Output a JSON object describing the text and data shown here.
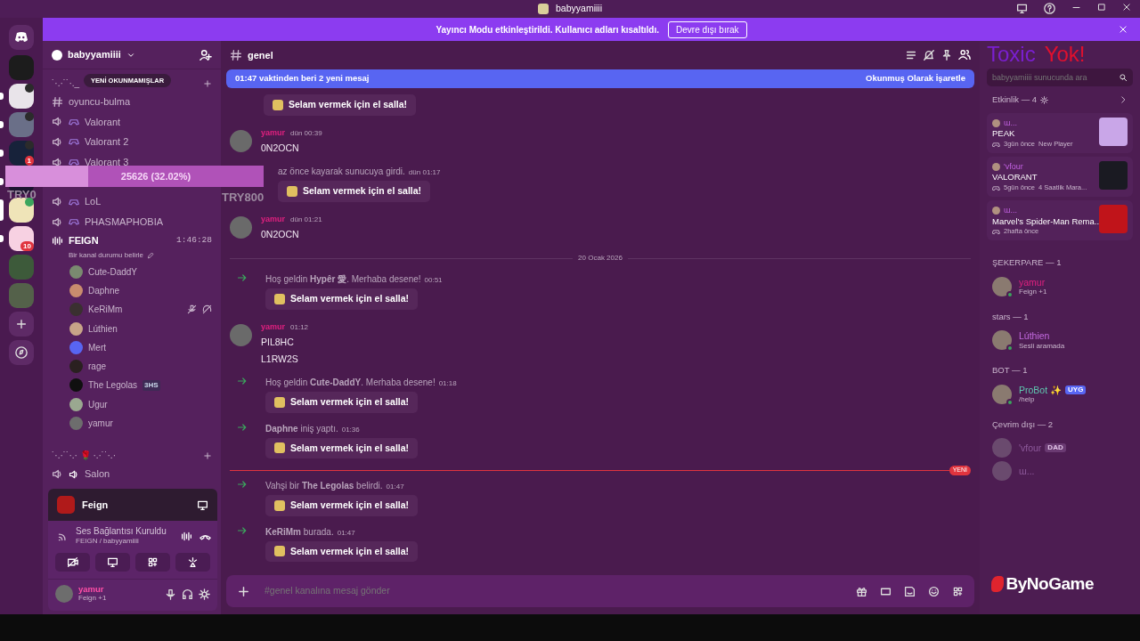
{
  "title_bar": {
    "title": "babyyamiiii"
  },
  "streamer_banner": {
    "text": "Yayıncı Modu etkinleştirildi. Kullanıcı adları kısaltıldı.",
    "button": "Devre dışı bırak"
  },
  "servers": [
    {
      "selected": false,
      "unread": false,
      "voice": false
    },
    {
      "selected": false,
      "unread": true,
      "voice": true
    },
    {
      "selected": false,
      "unread": true,
      "voice": true
    },
    {
      "selected": false,
      "unread": true,
      "voice": true,
      "mentions": "1"
    },
    {
      "selected": false,
      "unread": true,
      "voice": false
    },
    {
      "selected": true,
      "unread": false,
      "voice": true
    },
    {
      "selected": false,
      "unread": true,
      "voice": false,
      "mentions": "10"
    },
    {
      "selected": false,
      "unread": false,
      "voice": false
    },
    {
      "selected": false,
      "unread": false,
      "voice": false
    }
  ],
  "sidebar": {
    "server_name": "babyyamiiii",
    "unread_pill": "YENİ OKUNMAMIŞLAR",
    "categories": [
      {
        "name": "˙·.·˙˙·._",
        "channels": [
          {
            "kind": "text",
            "name": "oyuncu-bulma"
          },
          {
            "kind": "voice",
            "name": "Valorant",
            "activity": true
          },
          {
            "kind": "voice",
            "name": "Valorant 2",
            "activity": true
          },
          {
            "kind": "voice",
            "name": "Valorant 3",
            "activity": true
          },
          {
            "kind": "voice",
            "name": "LoL",
            "activity": true
          },
          {
            "kind": "voice",
            "name": "PHASMAPHOBIA",
            "activity": true
          },
          {
            "kind": "live",
            "name": "FEIGN",
            "timer": "1:46:28",
            "status": "Bir kanal durumu belirle",
            "members": [
              {
                "name": "Cute-DaddY",
                "muted": false
              },
              {
                "name": "Daphne",
                "muted": false
              },
              {
                "name": "KeRiMm",
                "muted": true
              },
              {
                "name": "Lúthien",
                "muted": false
              },
              {
                "name": "Mert",
                "muted": false
              },
              {
                "name": "rage",
                "muted": false
              },
              {
                "name": "The Legolas",
                "muted": false,
                "tag": "3HS"
              },
              {
                "name": "Ugur",
                "muted": false
              },
              {
                "name": "yamur",
                "muted": false
              }
            ]
          }
        ]
      },
      {
        "name": "˙·.·˙˙·.· 🌹 ·.·˙˙·.·",
        "channels": [
          {
            "kind": "voice",
            "name": "Salon",
            "activity": false
          }
        ]
      }
    ]
  },
  "voice_panel": {
    "stream": "Feign",
    "status": "Ses Bağlantısı Kuruldu",
    "location": "FEIGN / babyyamiiii"
  },
  "user_panel": {
    "name": "yamur",
    "activity": "Feign +1"
  },
  "chat": {
    "channel": "genel",
    "search": {
      "placeholder": "babyyamiiii sunucunda ara"
    },
    "new_bar": {
      "text": "01:47 vaktinden beri 2 yeni mesaj",
      "action": "Okunmuş Olarak İşaretle"
    },
    "items": [
      {
        "kind": "wave",
        "wave": "Selam vermek için el salla!"
      },
      {
        "kind": "message",
        "author": "yamur",
        "time": "dün 00:39",
        "lines": [
          "0N2OCN"
        ]
      },
      {
        "kind": "join",
        "text": "az önce kayarak sunucuya girdi.",
        "time": "dün 01:17",
        "wave": "Selam vermek için el salla!"
      },
      {
        "kind": "message",
        "author": "yamur",
        "time": "dün 01:21",
        "lines": [
          "0N2OCN"
        ]
      },
      {
        "kind": "date",
        "text": "20 Ocak 2026"
      },
      {
        "kind": "join",
        "text": "Hoş geldin **Hypêr 愛**. Merhaba desene!",
        "time": "00:51",
        "wave": "Selam vermek için el salla!"
      },
      {
        "kind": "message",
        "author": "yamur",
        "time": "01:12",
        "lines": [
          "PIL8HC",
          "L1RW2S"
        ]
      },
      {
        "kind": "join",
        "text": "Hoş geldin **Cute-DaddY**. Merhaba desene!",
        "time": "01:18",
        "wave": "Selam vermek için el salla!"
      },
      {
        "kind": "join",
        "text": "**Daphne** iniş yaptı.",
        "time": "01:36",
        "wave": "Selam vermek için el salla!"
      },
      {
        "kind": "new",
        "text": "YENİ"
      },
      {
        "kind": "join",
        "text": "Vahşi bir **The Legolas** belirdi.",
        "time": "01:47",
        "wave": "Selam vermek için el salla!"
      },
      {
        "kind": "join",
        "text": "**KeRiMm** burada.",
        "time": "01:47",
        "wave": "Selam vermek için el salla!"
      }
    ],
    "composer": {
      "placeholder": "#genel kanalına mesaj gönder"
    }
  },
  "members": {
    "activity_header": "Etkinlik — 4",
    "activities": [
      {
        "user": "ɯ...",
        "game": "PEAK",
        "details": [
          "3gün önce",
          "New Player"
        ],
        "color": "#c9a6e8"
      },
      {
        "user": "'vfour",
        "game": "VALORANT",
        "details": [
          "5gün önce",
          "4 Saatlik Mara..."
        ],
        "color": "#1a1a22"
      },
      {
        "user": "ɯ...",
        "game": "Marvel's Spider-Man Rema...",
        "details": [
          "2hafta önce"
        ],
        "color": "#c0141a"
      }
    ],
    "groups": [
      {
        "name": "ŞEKERPARE — 1",
        "members": [
          {
            "name": "yamur",
            "color": "#e0207f",
            "status": "Feign +1",
            "online": true
          }
        ]
      },
      {
        "name": "stars — 1",
        "members": [
          {
            "name": "Lúthien",
            "color": "#c46ae0",
            "status": "Sesli aramada",
            "online": true
          }
        ]
      },
      {
        "name": "BOT — 1",
        "members": [
          {
            "name": "ProBot ✨",
            "color": "#5fc8b0",
            "status": "/help",
            "online": true,
            "tag": "UYG"
          }
        ]
      },
      {
        "name": "Çevrim dışı — 2",
        "members": [
          {
            "name": "'vfour",
            "color": "#8e5a9c",
            "online": false,
            "tag": "DAD"
          },
          {
            "name": "ɯ...",
            "color": "#8e5a9c",
            "online": false
          }
        ]
      }
    ]
  },
  "overlay": {
    "progress_text": "25626 (32.02%)",
    "level": 0.32,
    "labels": [
      "TRY0",
      "TRY800"
    ],
    "headline": [
      {
        "text": "Toxic",
        "color": "#7a1fd0"
      },
      {
        "text": "Yok!",
        "color": "#e0102e"
      }
    ],
    "logo": "ByNoGame"
  }
}
